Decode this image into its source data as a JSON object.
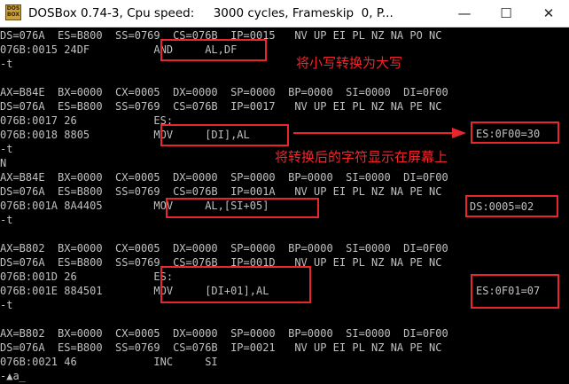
{
  "window": {
    "title": "DOSBox 0.74-3, Cpu speed:     3000 cycles, Frameskip  0, P...",
    "icon_text": "DOS BOX",
    "minimize_glyph": "—",
    "maximize_glyph": "☐",
    "close_glyph": "✕"
  },
  "terminal": {
    "lines": [
      "DS=076A  ES=B800  SS=0769  CS=076B  IP=0015   NV UP EI PL NZ NA PO NC",
      "076B:0015 24DF          AND     AL,DF",
      "-t",
      "",
      "AX=B84E  BX=0000  CX=0005  DX=0000  SP=0000  BP=0000  SI=0000  DI=0F00",
      "DS=076A  ES=B800  SS=0769  CS=076B  IP=0017   NV UP EI PL NZ NA PE NC",
      "076B:0017 26            ES:",
      "076B:0018 8805          MOV     [DI],AL",
      "-t",
      "N",
      "AX=B84E  BX=0000  CX=0005  DX=0000  SP=0000  BP=0000  SI=0000  DI=0F00",
      "DS=076A  ES=B800  SS=0769  CS=076B  IP=001A   NV UP EI PL NZ NA PE NC",
      "076B:001A 8A4405        MOV     AL,[SI+05]",
      "-t",
      "",
      "AX=B802  BX=0000  CX=0005  DX=0000  SP=0000  BP=0000  SI=0000  DI=0F00",
      "DS=076A  ES=B800  SS=0769  CS=076B  IP=001D   NV UP EI PL NZ NA PE NC",
      "076B:001D 26            ES:",
      "076B:001E 884501        MOV     [DI+01],AL",
      "-t",
      "",
      "AX=B802  BX=0000  CX=0005  DX=0000  SP=0000  BP=0000  SI=0000  DI=0F00",
      "DS=076A  ES=B800  SS=0769  CS=076B  IP=0021   NV UP EI PL NZ NA PE NC",
      "076B:0021 46            INC     SI",
      "-▲a_"
    ]
  },
  "annotations": {
    "note_lowercase_to_upper": "将小写转换为大写",
    "note_store_on_screen": "将转换后的字符显示在屏幕上",
    "mem_es_0f00": "ES:0F00=30",
    "mem_ds_0005": "DS:0005=02",
    "mem_es_0f01": "ES:0F01=07"
  },
  "colors": {
    "annotation_red": "#e8262c",
    "terminal_text": "#c0c0c0",
    "terminal_bg": "#000000"
  }
}
